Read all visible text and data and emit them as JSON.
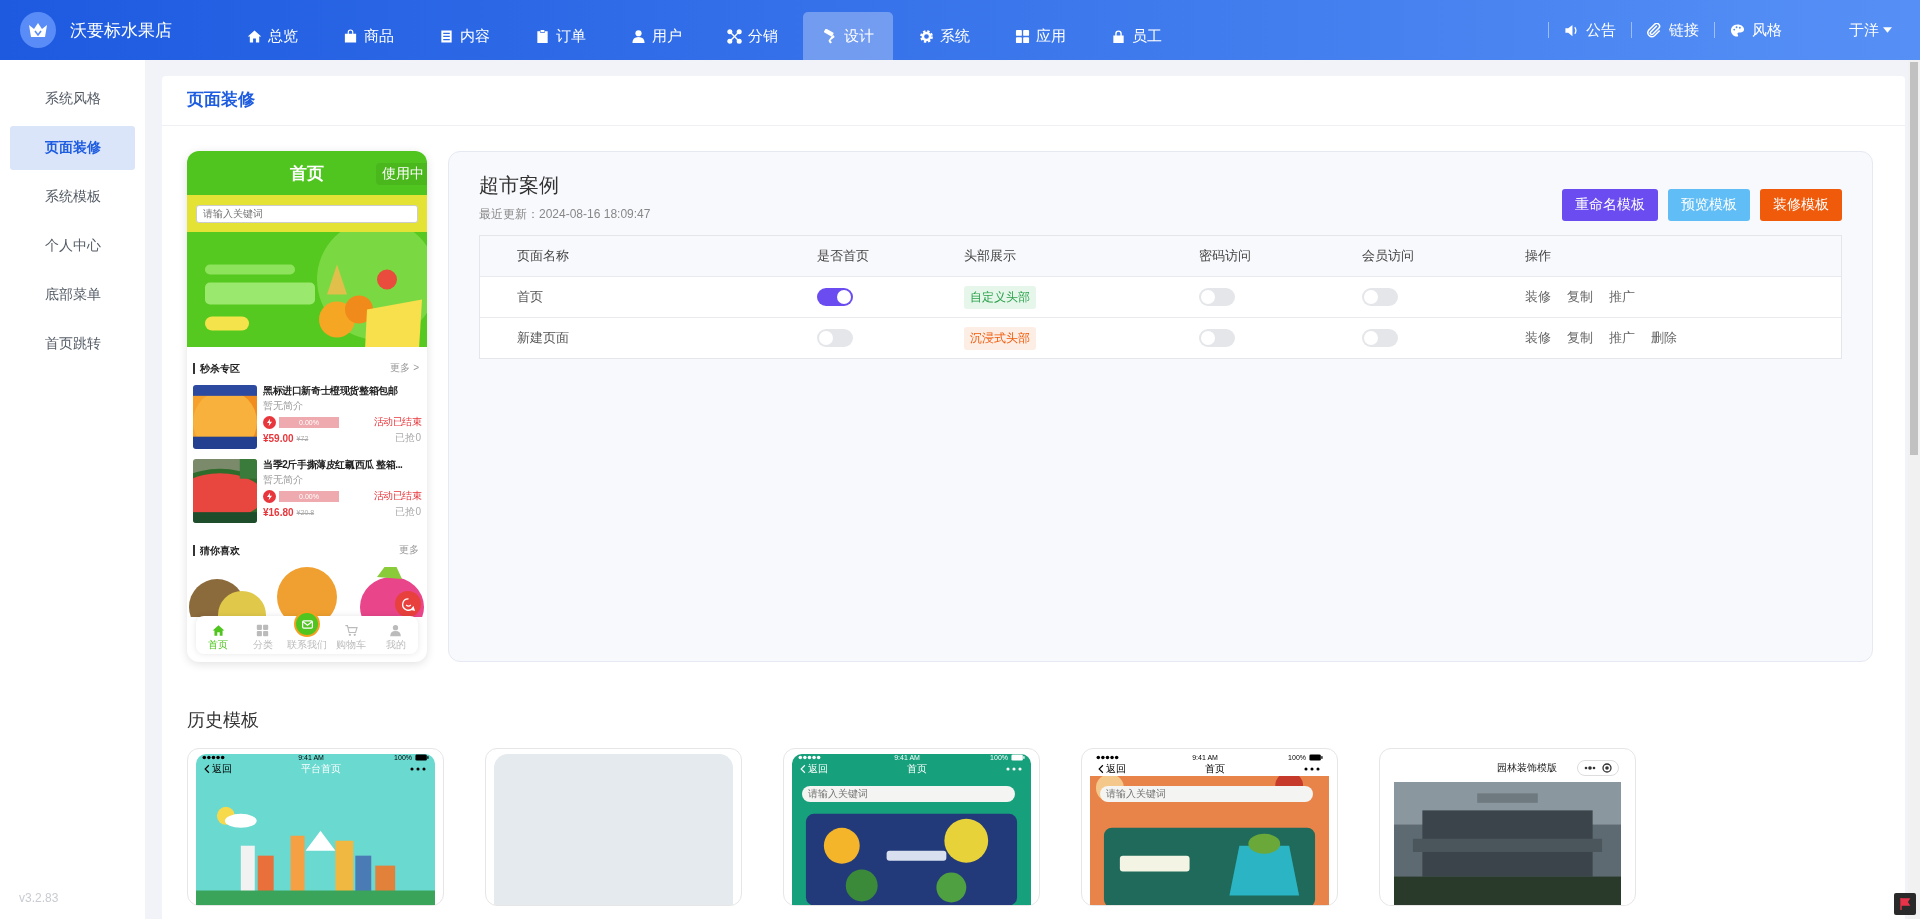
{
  "brand": {
    "name": "沃要标水果店"
  },
  "nav": [
    {
      "label": "总览",
      "selected": false
    },
    {
      "label": "商品",
      "selected": false
    },
    {
      "label": "内容",
      "selected": false
    },
    {
      "label": "订单",
      "selected": false
    },
    {
      "label": "用户",
      "selected": false
    },
    {
      "label": "分销",
      "selected": false
    },
    {
      "label": "设计",
      "selected": true
    },
    {
      "label": "系统",
      "selected": false
    },
    {
      "label": "应用",
      "selected": false
    },
    {
      "label": "员工",
      "selected": false
    }
  ],
  "top_links": [
    "公告",
    "链接",
    "风格"
  ],
  "user": {
    "name": "于洋"
  },
  "sidebar": {
    "items": [
      {
        "label": "系统风格",
        "selected": false
      },
      {
        "label": "页面装修",
        "selected": true
      },
      {
        "label": "系统模板",
        "selected": false
      },
      {
        "label": "个人中心",
        "selected": false
      },
      {
        "label": "底部菜单",
        "selected": false
      },
      {
        "label": "首页跳转",
        "selected": false
      }
    ],
    "version": "v3.2.83"
  },
  "page_title": "页面装修",
  "preview": {
    "title": "首页",
    "status": "使用中",
    "search_placeholder": "请输入关键词",
    "flash_sale": {
      "title": "秒杀专区",
      "more": "更多 >",
      "products": [
        {
          "name": "黑标进口新奇士橙现货整箱包邮",
          "intro": "暂无简介",
          "progress": "0.00%",
          "level": 0,
          "state": "活动已结束",
          "price": "¥59.00",
          "old_price": "¥72",
          "sold": "已抢0"
        },
        {
          "name": "当季2斤手撕薄皮红瓤西瓜 整箱...",
          "intro": "暂无简介",
          "progress": "0.00%",
          "level": 0,
          "state": "活动已结束",
          "price": "¥16.80",
          "old_price": "¥20.8",
          "sold": "已抢0"
        }
      ]
    },
    "recommend": {
      "title": "猜你喜欢",
      "more": "更多"
    },
    "tabs": [
      {
        "label": "首页",
        "selected": true
      },
      {
        "label": "分类",
        "selected": false
      },
      {
        "label": "联系我们",
        "selected": false
      },
      {
        "label": "购物车",
        "selected": false
      },
      {
        "label": "我的",
        "selected": false
      }
    ]
  },
  "template": {
    "name": "超市案例",
    "updated": "最近更新：2024-08-16 18:09:47",
    "buttons": [
      {
        "label": "重命名模板",
        "color": "#6b4cf0"
      },
      {
        "label": "预览模板",
        "color": "#60bdf6"
      },
      {
        "label": "装修模板",
        "color": "#f05a0b"
      }
    ],
    "table": {
      "columns": [
        "页面名称",
        "是否首页",
        "头部展示",
        "密码访问",
        "会员访问",
        "操作"
      ],
      "rows": [
        {
          "name": "首页",
          "is_home": true,
          "header": {
            "text": "自定义头部",
            "kind": "custom"
          },
          "password": false,
          "member": false,
          "actions": [
            "装修",
            "复制",
            "推广"
          ]
        },
        {
          "name": "新建页面",
          "is_home": false,
          "header": {
            "text": "沉浸式头部",
            "kind": "immersive"
          },
          "password": false,
          "member": false,
          "actions": [
            "装修",
            "复制",
            "推广",
            "删除"
          ]
        }
      ]
    }
  },
  "history": {
    "title": "历史模板",
    "templates": [
      {
        "kind": "city",
        "time": "9:41 AM",
        "battery": "100%",
        "back": "返回",
        "title": "平台首页"
      },
      {
        "kind": "blank"
      },
      {
        "kind": "lemon",
        "time": "9:41 AM",
        "battery": "100%",
        "back": "返回",
        "title": "首页",
        "placeholder": "请输入关键词"
      },
      {
        "kind": "fruit",
        "time": "9:41 AM",
        "battery": "100%",
        "back": "返回",
        "title": "首页",
        "placeholder": "请输入关键词"
      },
      {
        "kind": "garden",
        "title": "园林装饰模版"
      }
    ]
  }
}
